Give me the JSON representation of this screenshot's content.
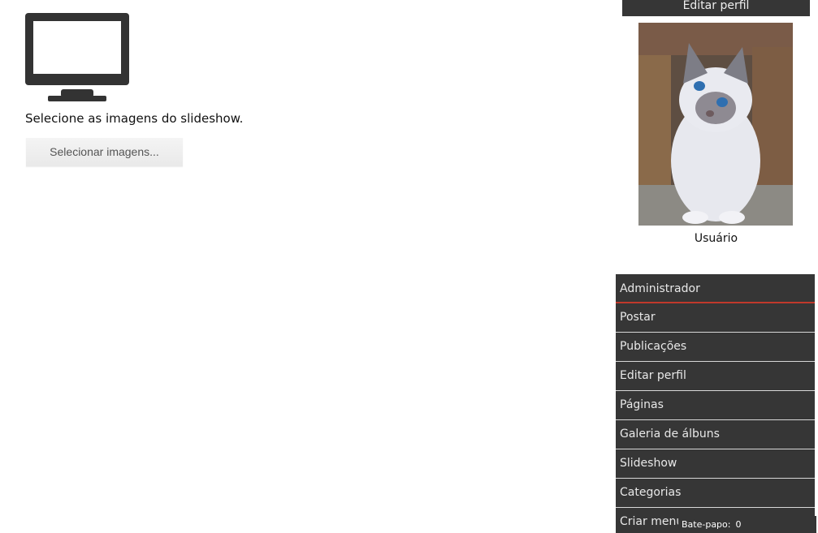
{
  "main": {
    "instruction": "Selecione as imagens do slideshow.",
    "select_button": "Selecionar imagens..."
  },
  "profile": {
    "edit_label": "Editar perfil",
    "username": "Usuário"
  },
  "admin_menu": {
    "header": "Administrador",
    "items": [
      {
        "label": "Postar"
      },
      {
        "label": "Publicações"
      },
      {
        "label": "Editar perfil"
      },
      {
        "label": "Páginas"
      },
      {
        "label": "Galeria de álbuns"
      },
      {
        "label": "Slideshow"
      },
      {
        "label": "Categorias"
      },
      {
        "label": "Criar menu"
      }
    ]
  },
  "chat": {
    "label": "Bate-papo:",
    "count": "0"
  },
  "icons": {
    "monitor": "monitor-icon"
  },
  "colors": {
    "menu_bg": "#363636",
    "accent": "#c0392b"
  }
}
